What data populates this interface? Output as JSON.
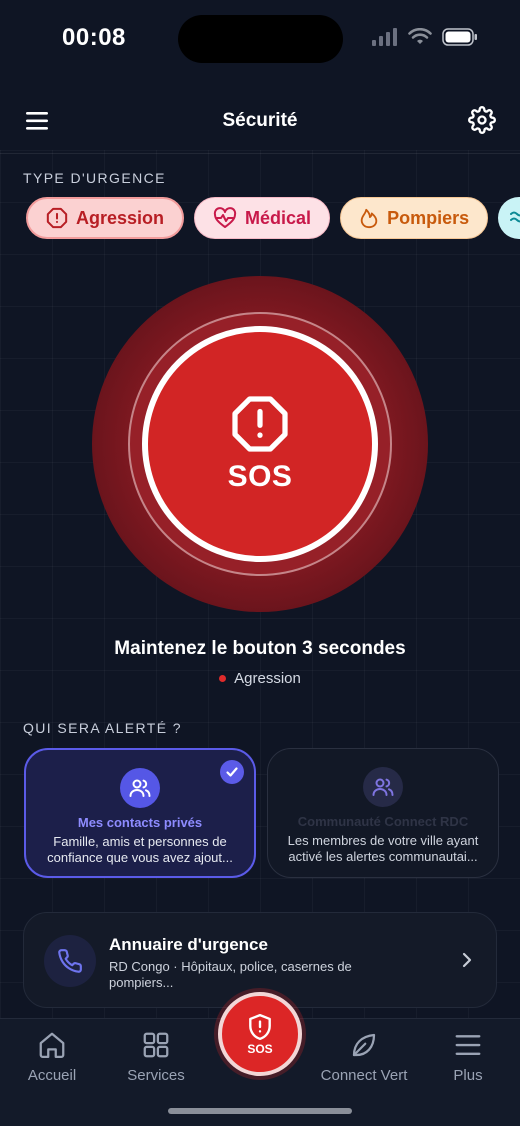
{
  "status_bar": {
    "time": "00:08"
  },
  "header": {
    "title": "Sécurité"
  },
  "emergency_type": {
    "label": "TYPE D'URGENCE",
    "chips": [
      {
        "label": "Agression",
        "icon": "alert-octagon-icon",
        "color": "#b81e24"
      },
      {
        "label": "Médical",
        "icon": "heart-pulse-icon",
        "color": "#c8194a"
      },
      {
        "label": "Pompiers",
        "icon": "flame-icon",
        "color": "#c85a0c"
      },
      {
        "label": "",
        "icon": "waves-icon",
        "color": "#0c8a95"
      }
    ]
  },
  "sos": {
    "label": "SOS",
    "hold_text": "Maintenez le bouton 3 secondes",
    "selected_type": "Agression",
    "color": "#d22525"
  },
  "alert_section": {
    "label": "QUI SERA ALERTÉ ?",
    "cards": [
      {
        "title": "Mes contacts privés",
        "desc": "Famille, amis et personnes de confiance que vous avez ajout...",
        "selected": true,
        "icon": "users-icon"
      },
      {
        "title": "Communauté Connect RDC",
        "desc": "Les membres de votre ville ayant activé les alertes communautai...",
        "selected": false,
        "icon": "users-icon"
      }
    ]
  },
  "directory": {
    "title": "Annuaire d'urgence",
    "desc": "RD Congo · Hôpitaux, police, casernes de pompiers...",
    "icon": "phone-icon"
  },
  "tabbar": {
    "tabs": [
      {
        "label": "Accueil",
        "icon": "home-icon"
      },
      {
        "label": "Services",
        "icon": "grid-icon"
      },
      {
        "label": "SOS",
        "icon": "shield-alert-icon"
      },
      {
        "label": "Connect Vert",
        "icon": "leaf-icon"
      },
      {
        "label": "Plus",
        "icon": "menu-icon"
      }
    ]
  }
}
